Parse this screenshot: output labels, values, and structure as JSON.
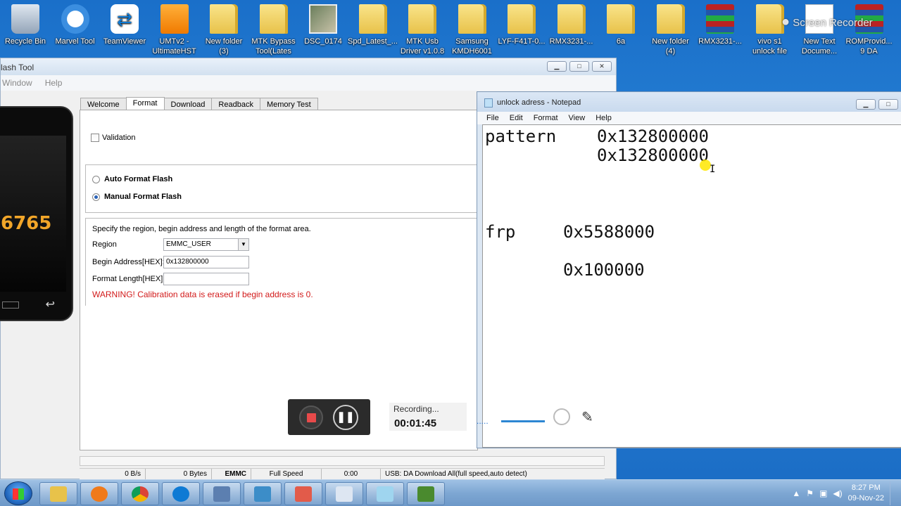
{
  "desktop_icons": [
    {
      "label": "Recycle Bin",
      "label2": "",
      "icon": "recycle-bin-icon"
    },
    {
      "label": "Marvel Tool",
      "label2": "",
      "icon": "marvel-tool-icon"
    },
    {
      "label": "TeamViewer",
      "label2": "",
      "icon": "teamviewer-icon"
    },
    {
      "label": "UMTv2 -",
      "label2": "UltimateHST",
      "icon": "umt-icon"
    },
    {
      "label": "New folder",
      "label2": "(3)",
      "icon": "folder-icon"
    },
    {
      "label": "MTK Bypass",
      "label2": "Tool(Lates",
      "icon": "folder-icon"
    },
    {
      "label": "DSC_0174",
      "label2": "",
      "icon": "photo-icon"
    },
    {
      "label": "Spd_Latest_...",
      "label2": "",
      "icon": "folder-icon"
    },
    {
      "label": "MTK Usb",
      "label2": "Driver v1.0.8",
      "icon": "folder-icon"
    },
    {
      "label": "Samsung",
      "label2": "KMDH6001",
      "icon": "folder-icon"
    },
    {
      "label": "LYF-F41T-0...",
      "label2": "",
      "icon": "folder-icon"
    },
    {
      "label": "RMX3231-...",
      "label2": "",
      "icon": "folder-icon"
    },
    {
      "label": "6a",
      "label2": "",
      "icon": "folder-icon"
    },
    {
      "label": "New folder",
      "label2": "(4)",
      "icon": "folder-icon"
    },
    {
      "label": "RMX3231-...",
      "label2": "",
      "icon": "winrar-icon"
    },
    {
      "label": "vivo s1",
      "label2": "unlock file",
      "icon": "folder-icon"
    },
    {
      "label": "New Text",
      "label2": "Docume...",
      "icon": "text-file-icon"
    },
    {
      "label": "ROMProvid...",
      "label2": "9 DA",
      "icon": "winrar-icon"
    }
  ],
  "watermark": "Screen Recorder",
  "flash_tool": {
    "title": "lash Tool",
    "menu": [
      "Window",
      "Help"
    ],
    "chip_label": "6765",
    "tabs": [
      "Welcome",
      "Format",
      "Download",
      "Readback",
      "Memory Test"
    ],
    "active_tab": "Format",
    "validation_label": "Validation",
    "validation_checked": false,
    "auto_format_label": "Auto Format Flash",
    "manual_format_label": "Manual Format Flash",
    "selected_mode": "Manual Format Flash",
    "spec_text": "Specify the region, begin address and length of the format area.",
    "region_label": "Region",
    "region_value": "EMMC_USER",
    "begin_label": "Begin Address[HEX]:",
    "begin_value": "0x132800000",
    "length_label": "Format Length[HEX]:",
    "length_value": "",
    "warning": "WARNING! Calibration data is erased if begin address is 0.",
    "status": {
      "speed": "0 B/s",
      "bytes": "0 Bytes",
      "storage": "EMMC",
      "mode": "Full Speed",
      "time": "0:00",
      "usb": "USB: DA Download All(full speed,auto detect)"
    }
  },
  "notepad": {
    "title": "unlock adress - Notepad",
    "menu": [
      "File",
      "Edit",
      "Format",
      "View",
      "Help"
    ],
    "lines": {
      "pattern_label": "pattern",
      "pattern_addr": "0x132800000",
      "pattern_len": "0x132800000",
      "frp_label": "frp",
      "frp_addr": "0x5588000",
      "frp_len": "0x100000"
    }
  },
  "recorder": {
    "status_label": "Recording...",
    "elapsed": "00:01:45",
    "dots": "....."
  },
  "taskbar": {
    "time": "8:27 PM",
    "date": "09-Nov-22"
  }
}
